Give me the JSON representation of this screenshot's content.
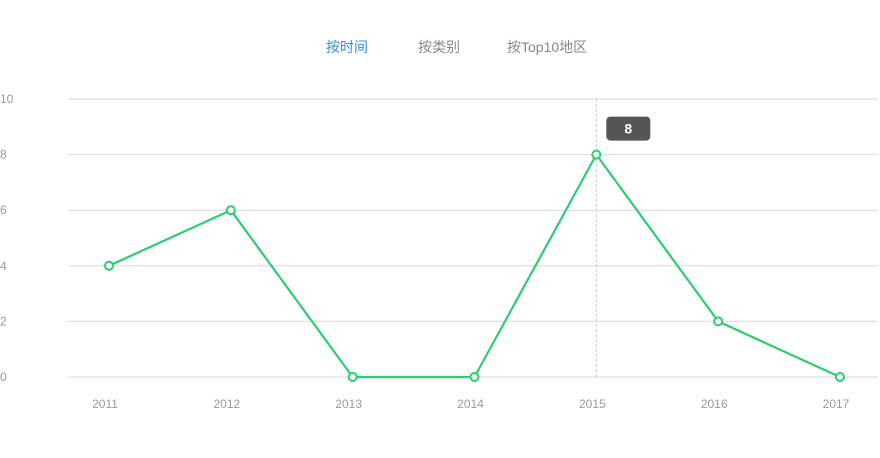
{
  "tabs": [
    {
      "label": "按时间",
      "active": true
    },
    {
      "label": "按类别",
      "active": false
    },
    {
      "label": "按Top10地区",
      "active": false
    }
  ],
  "colors": {
    "active_tab": "#2e8fe0",
    "inactive_tab": "#888888",
    "line": "#2ecc71",
    "grid": "#d9d9d9",
    "tooltip_bg": "#555555"
  },
  "tooltip": {
    "value": "8",
    "category": "2015"
  },
  "chart_data": {
    "type": "line",
    "categories": [
      "2011",
      "2012",
      "2013",
      "2014",
      "2015",
      "2016",
      "2017"
    ],
    "values": [
      4,
      6,
      0,
      0,
      8,
      2,
      0
    ],
    "yticks": [
      "0",
      "2",
      "4",
      "6",
      "8",
      "10"
    ],
    "ylim": [
      0,
      10
    ],
    "grid": true,
    "title": "",
    "xlabel": "",
    "ylabel": ""
  }
}
